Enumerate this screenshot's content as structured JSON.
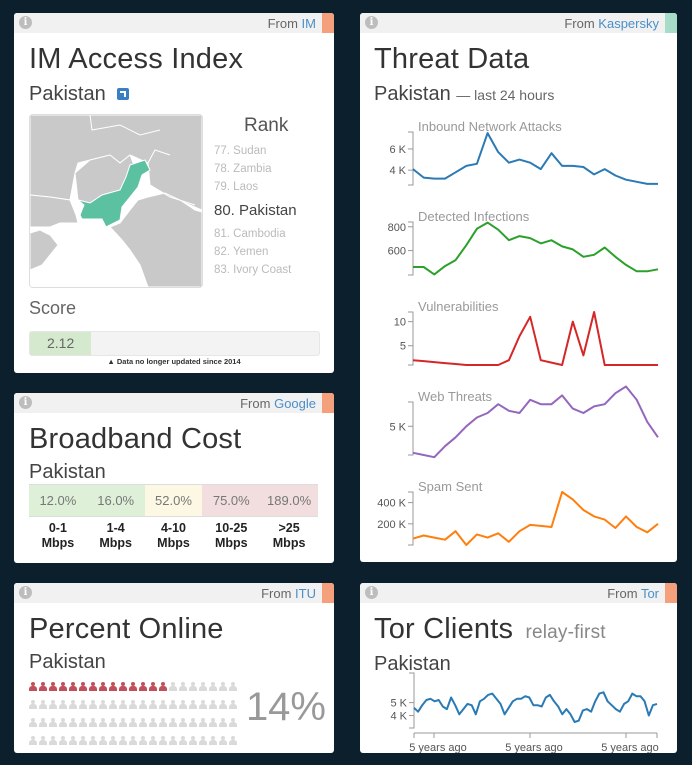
{
  "colors": {
    "background": "#0c1f2c",
    "accent_orange": "#f4a07c",
    "accent_teal": "#a6dcc8",
    "link_blue": "#4a8fc7",
    "pakistan_green": "#5cc1a0",
    "map_land": "#c9c9c9",
    "person_online": "#c0505a",
    "person_offline": "#dadada",
    "broadband_green": "#dff0d8",
    "broadband_yellow": "#fcf8e3",
    "broadband_red": "#f2dede",
    "attacks_line": "#2a7ab5",
    "infections_line": "#2ca02c",
    "vulnerabilities_line": "#d62728",
    "web_threats_line": "#9467bd",
    "spam_line": "#ff7f0e",
    "tor_line": "#2a7ab5"
  },
  "im_card": {
    "source_prefix": "From",
    "source_name": "IM",
    "title": "IM Access Index",
    "country": "Pakistan",
    "external_link_icon": "external-link-icon",
    "rank_title": "Rank",
    "ranks": [
      {
        "label": "77. Sudan",
        "current": false
      },
      {
        "label": "78. Zambia",
        "current": false
      },
      {
        "label": "79. Laos",
        "current": false
      },
      {
        "label": "80. Pakistan",
        "current": true
      },
      {
        "label": "81. Cambodia",
        "current": false
      },
      {
        "label": "82. Yemen",
        "current": false
      },
      {
        "label": "83. Ivory Coast",
        "current": false
      }
    ],
    "score_label": "Score",
    "score_value": "2.12",
    "score_fraction": 0.212,
    "note_icon": "warning-icon",
    "note": "Data no longer updated since 2014"
  },
  "broadband_card": {
    "source_prefix": "From",
    "source_name": "Google",
    "title": "Broadband Cost",
    "country": "Pakistan",
    "tiers": [
      {
        "value": "12.0%",
        "label_line1": "0-1",
        "label_line2": "Mbps",
        "level": "green"
      },
      {
        "value": "16.0%",
        "label_line1": "1-4",
        "label_line2": "Mbps",
        "level": "green"
      },
      {
        "value": "52.0%",
        "label_line1": "4-10",
        "label_line2": "Mbps",
        "level": "yellow"
      },
      {
        "value": "75.0%",
        "label_line1": "10-25",
        "label_line2": "Mbps",
        "level": "red"
      },
      {
        "value": "189.0%",
        "label_line1": ">25",
        "label_line2": "Mbps",
        "level": "red"
      }
    ]
  },
  "online_card": {
    "source_prefix": "From",
    "source_name": "ITU",
    "title": "Percent Online",
    "country": "Pakistan",
    "percent": 14,
    "percent_label": "14%",
    "total_people": 100,
    "person_icon": "person-icon"
  },
  "threat_card": {
    "source_prefix": "From",
    "source_name": "Kaspersky",
    "title": "Threat Data",
    "country": "Pakistan",
    "period": "— last 24 hours"
  },
  "tor_card": {
    "source_prefix": "From",
    "source_name": "Tor",
    "title": "Tor Clients",
    "subtitle": "relay-first",
    "country": "Pakistan"
  },
  "chart_data": [
    {
      "type": "line",
      "title": "Inbound Network Attacks",
      "yticks": [
        {
          "value": 4000,
          "label": "4 K"
        },
        {
          "value": 6000,
          "label": "6 K"
        }
      ],
      "ylim": [
        2600,
        7600
      ],
      "values": [
        4100,
        3300,
        3200,
        3200,
        3800,
        4400,
        4600,
        7500,
        5700,
        4700,
        5000,
        4700,
        4100,
        5600,
        4400,
        4400,
        4300,
        3600,
        4100,
        3500,
        3100,
        2900,
        2700,
        2700
      ]
    },
    {
      "type": "line",
      "title": "Detected Infections",
      "yticks": [
        {
          "value": 600,
          "label": "600"
        },
        {
          "value": 800,
          "label": "800"
        }
      ],
      "ylim": [
        395,
        840
      ],
      "values": [
        462,
        462,
        400,
        470,
        520,
        645,
        783,
        835,
        775,
        687,
        722,
        705,
        660,
        687,
        635,
        610,
        548,
        565,
        626,
        548,
        480,
        426,
        426,
        443
      ]
    },
    {
      "type": "line",
      "title": "Vulnerabilities",
      "yticks": [
        {
          "value": 5,
          "label": "5"
        },
        {
          "value": 10,
          "label": "10"
        }
      ],
      "ylim": [
        1,
        12
      ],
      "values": [
        2,
        1.8,
        1.6,
        1.4,
        1.2,
        1,
        1,
        1,
        1,
        2,
        7,
        11,
        2,
        1.5,
        1,
        10,
        3,
        12,
        1,
        1,
        1,
        1,
        1,
        1
      ]
    },
    {
      "type": "line",
      "title": "Web Threats",
      "yticks": [
        {
          "value": 5000,
          "label": "5 K"
        }
      ],
      "ylim": [
        3700,
        6100
      ],
      "values": [
        3800,
        3700,
        3600,
        4100,
        4500,
        5000,
        5400,
        5600,
        6000,
        5700,
        5600,
        6200,
        6000,
        6000,
        6400,
        5800,
        5600,
        5900,
        6000,
        6500,
        6800,
        6200,
        5200,
        4500
      ]
    },
    {
      "type": "line",
      "title": "Spam Sent",
      "yticks": [
        {
          "value": 200000,
          "label": "200 K"
        },
        {
          "value": 400000,
          "label": "400 K"
        }
      ],
      "ylim": [
        0,
        500000
      ],
      "values": [
        60000,
        90000,
        70000,
        50000,
        130000,
        0,
        100000,
        70000,
        110000,
        30000,
        130000,
        190000,
        180000,
        170000,
        500000,
        430000,
        330000,
        270000,
        240000,
        160000,
        270000,
        170000,
        120000,
        200000
      ]
    },
    {
      "type": "line",
      "title": "Tor Clients",
      "yticks": [
        {
          "value": 4000,
          "label": "4 K"
        },
        {
          "value": 5000,
          "label": "5 K"
        }
      ],
      "ylim": [
        3500,
        5900
      ],
      "xticks": [
        "5 years ago",
        "5 years ago",
        "5 years ago"
      ],
      "values": [
        4600,
        4300,
        4800,
        5200,
        5300,
        5100,
        5200,
        4700,
        4500,
        5400,
        4800,
        4100,
        4500,
        4900,
        4800,
        4100,
        5100,
        5300,
        5600,
        5700,
        5300,
        4900,
        4100,
        4600,
        5100,
        5300,
        5300,
        5500,
        5400,
        4800,
        4800,
        4700,
        5400,
        5600,
        5100,
        4700,
        4100,
        4500,
        4100,
        3500,
        3600,
        4400,
        4500,
        4300,
        5100,
        5700,
        5800,
        5100,
        4800,
        4500,
        4300,
        4900,
        5100,
        5700,
        5500,
        5500,
        5100,
        4000,
        4800,
        4900
      ]
    }
  ]
}
